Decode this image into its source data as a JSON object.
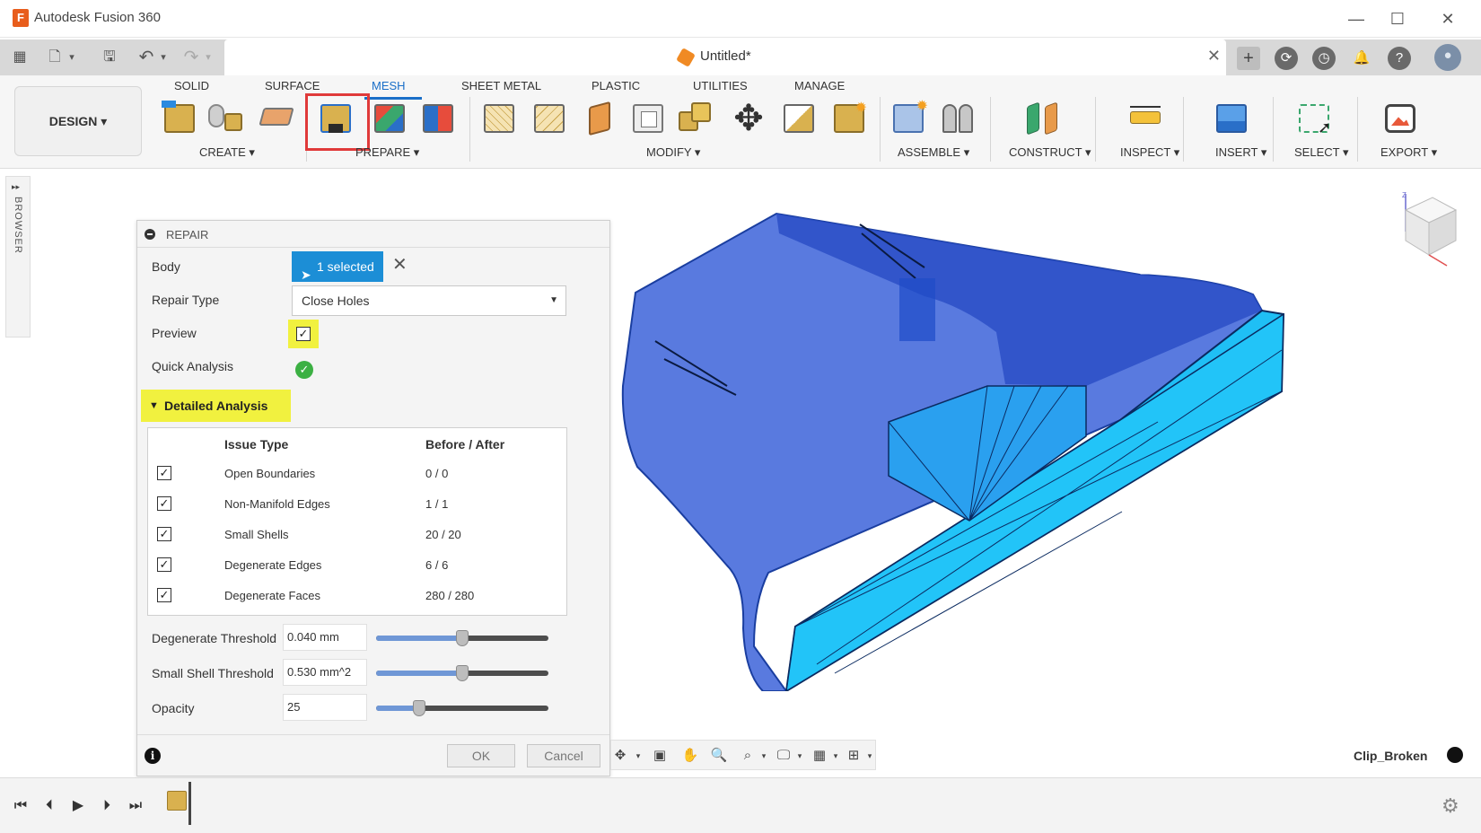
{
  "window": {
    "app_title": "Autodesk Fusion 360",
    "logo_letter": "F",
    "minimize": "—",
    "maximize": "☐",
    "close": "✕"
  },
  "quick_access": {
    "grid_icon": "▦",
    "file_icon": "🗋",
    "file_caret": "▾",
    "save_icon": "🖫",
    "undo_icon": "↶",
    "undo_caret": "▾",
    "redo_icon": "↷",
    "redo_caret": "▾"
  },
  "document_tab": {
    "title": "Untitled*",
    "close": "✕"
  },
  "top_right": {
    "add": "+",
    "online": "⟳",
    "history": "◷",
    "notifications": "🔔",
    "help": "?",
    "account": "●"
  },
  "workspace": {
    "label": "DESIGN ▾"
  },
  "ribbon_tabs": [
    "SOLID",
    "SURFACE",
    "MESH",
    "SHEET METAL",
    "PLASTIC",
    "UTILITIES",
    "MANAGE"
  ],
  "ribbon_groups": {
    "create": "CREATE ▾",
    "prepare": "PREPARE ▾",
    "modify": "MODIFY ▾",
    "assemble": "ASSEMBLE ▾",
    "construct": "CONSTRUCT ▾",
    "inspect": "INSPECT ▾",
    "insert": "INSERT ▾",
    "select": "SELECT ▾",
    "export": "EXPORT ▾"
  },
  "browser": {
    "label": "BROWSER",
    "expand": "▸▸"
  },
  "repair_panel": {
    "title": "REPAIR",
    "body_label": "Body",
    "body_selection": "1 selected",
    "clear": "✕",
    "repair_type_label": "Repair Type",
    "repair_type_value": "Close Holes",
    "preview_label": "Preview",
    "preview_checked": true,
    "quick_analysis_label": "Quick Analysis",
    "quick_analysis_status": "✓",
    "detailed_analysis_label": "Detailed Analysis",
    "table": {
      "headers": [
        "Issue Type",
        "Before / After"
      ],
      "rows": [
        {
          "issue": "Open Boundaries",
          "value": "0 / 0",
          "checked": true
        },
        {
          "issue": "Non-Manifold Edges",
          "value": "1 / 1",
          "checked": true
        },
        {
          "issue": "Small Shells",
          "value": "20 / 20",
          "checked": true
        },
        {
          "issue": "Degenerate Edges",
          "value": "6 / 6",
          "checked": true
        },
        {
          "issue": "Degenerate Faces",
          "value": "280 / 280",
          "checked": true
        }
      ]
    },
    "degenerate_threshold_label": "Degenerate Threshold",
    "degenerate_threshold_value": "0.040 mm",
    "degenerate_threshold_level": 0.5,
    "small_shell_threshold_label": "Small Shell Threshold",
    "small_shell_threshold_value": "0.530 mm^2",
    "small_shell_threshold_level": 0.5,
    "opacity_label": "Opacity",
    "opacity_value": "25",
    "opacity_level": 0.25,
    "info": "i",
    "ok_label": "OK",
    "cancel_label": "Cancel"
  },
  "nav_bar": {
    "orbit": "✥",
    "look": "▣",
    "pan": "✋",
    "zoom": "🔍",
    "fit": "⌕",
    "display": "🖵",
    "grid": "▦",
    "viewports": "⊞",
    "caret": "▾"
  },
  "document_name": "Clip_Broken",
  "timeline": {
    "first": "⏮",
    "prev": "⏴",
    "play": "▶",
    "next": "⏵",
    "last": "⏭",
    "settings": "⚙"
  },
  "colors": {
    "accent": "#1a6fc8",
    "selection_button": "#1c8ed6",
    "highlight_yellow": "#f1f13f",
    "mesh_dark_blue": "#1f4fd1",
    "mesh_cyan": "#1fbff5",
    "red_outline": "#e03a3a"
  }
}
